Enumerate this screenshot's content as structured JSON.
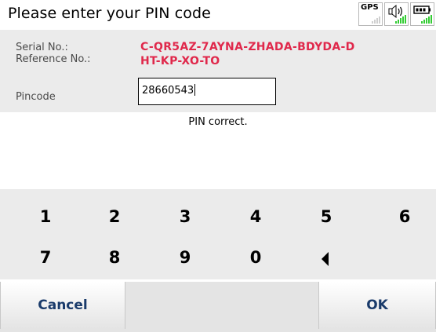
{
  "header": {
    "title": "Please enter your PIN code"
  },
  "status": [
    {
      "name": "gps-icon",
      "text": "GPS"
    },
    {
      "name": "speaker-icon"
    },
    {
      "name": "battery-icon"
    }
  ],
  "info": {
    "serial_label": "Serial No.:",
    "serial_value": "C-QR5AZ-7AYNA-ZHADA-BDYDA-D",
    "reference_label": "Reference No.:",
    "reference_value": "HT-KP-XO-TO"
  },
  "pin": {
    "label": "Pincode",
    "value": "28660543"
  },
  "message": "PIN correct.",
  "keypad": {
    "row1": [
      "1",
      "2",
      "3",
      "4",
      "5",
      "6"
    ],
    "row2": [
      "7",
      "8",
      "9",
      "0"
    ]
  },
  "buttons": {
    "cancel": "Cancel",
    "ok": "OK"
  },
  "colors": {
    "accent_red": "#e0284b",
    "button_text": "#1a3b6b",
    "panel_bg": "#ebebeb",
    "signal_green": "#33cc33"
  }
}
